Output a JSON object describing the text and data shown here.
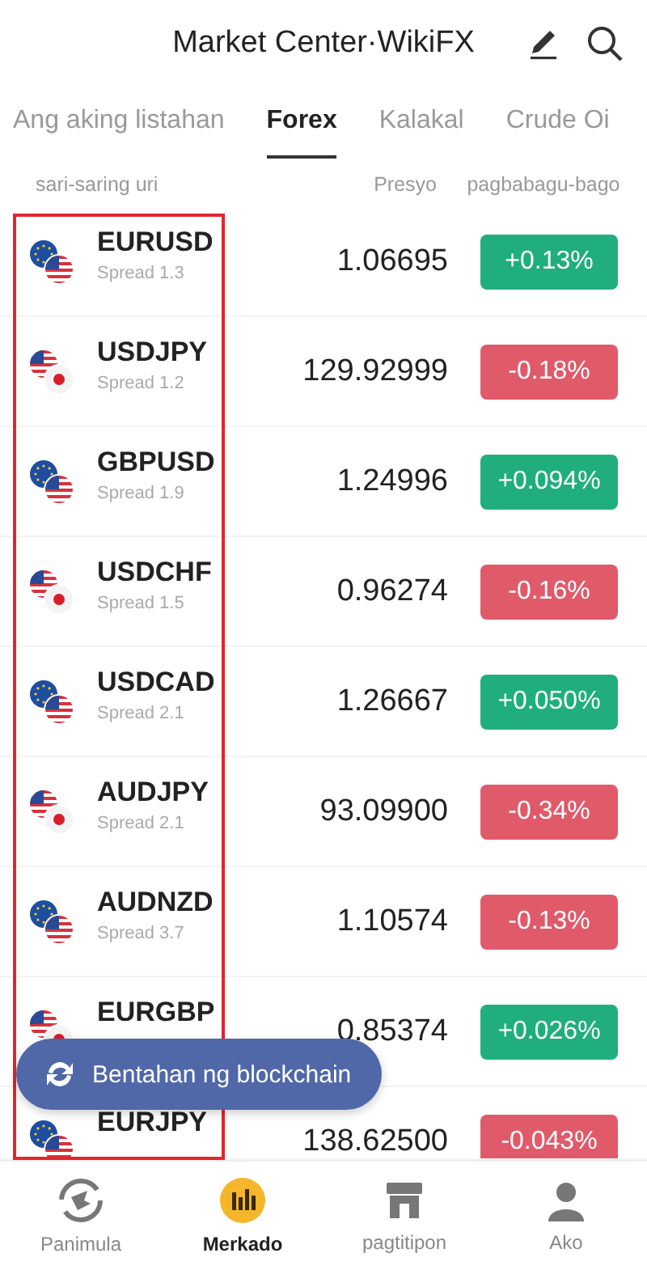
{
  "header": {
    "title": "Market Center·WikiFX"
  },
  "tabs": [
    {
      "label": "Ang aking listahan",
      "selected": false
    },
    {
      "label": "Forex",
      "selected": true
    },
    {
      "label": "Kalakal",
      "selected": false
    },
    {
      "label": "Crude Oi",
      "selected": false
    }
  ],
  "columns": {
    "name": "sari-saring uri",
    "price": "Presyo",
    "change": "pagbabagu-bago"
  },
  "rows": [
    {
      "symbol": "EURUSD",
      "spread": "Spread 1.3",
      "price": "1.06695",
      "change": "+0.13%",
      "color": "#1fae7c"
    },
    {
      "symbol": "USDJPY",
      "spread": "Spread 1.2",
      "price": "129.92999",
      "change": "-0.18%",
      "color": "#e05a6a"
    },
    {
      "symbol": "GBPUSD",
      "spread": "Spread 1.9",
      "price": "1.24996",
      "change": "+0.094%",
      "color": "#1fae7c"
    },
    {
      "symbol": "USDCHF",
      "spread": "Spread 1.5",
      "price": "0.96274",
      "change": "-0.16%",
      "color": "#e05a6a"
    },
    {
      "symbol": "USDCAD",
      "spread": "Spread 2.1",
      "price": "1.26667",
      "change": "+0.050%",
      "color": "#1fae7c"
    },
    {
      "symbol": "AUDJPY",
      "spread": "Spread 2.1",
      "price": "93.09900",
      "change": "-0.34%",
      "color": "#e05a6a"
    },
    {
      "symbol": "AUDNZD",
      "spread": "Spread 3.7",
      "price": "1.10574",
      "change": "-0.13%",
      "color": "#e05a6a"
    },
    {
      "symbol": "EURGBP",
      "price": "0.85374",
      "change": "+0.026%",
      "color": "#1fae7c"
    },
    {
      "symbol": "EURJPY",
      "price": "138.62500",
      "change": "-0.043%",
      "color": "#e05a6a"
    }
  ],
  "floating_button": {
    "label": "Bentahan ng blockchain"
  },
  "bottom_nav": [
    {
      "label": "Panimula",
      "kind": "home",
      "selected": false
    },
    {
      "label": "Merkado",
      "kind": "market",
      "selected": true
    },
    {
      "label": "pagtitipon",
      "kind": "store",
      "selected": false
    },
    {
      "label": "Ako",
      "kind": "profile",
      "selected": false
    }
  ]
}
